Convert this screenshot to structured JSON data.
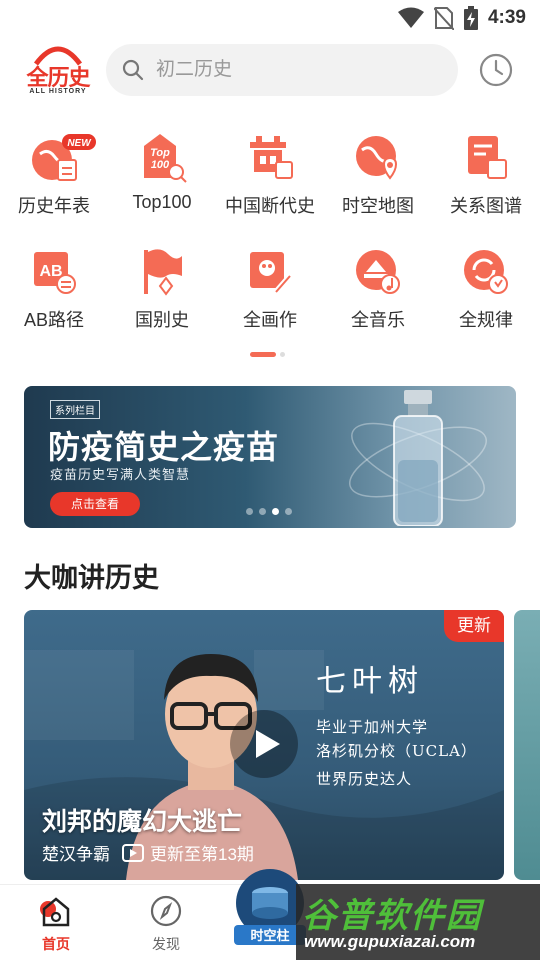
{
  "status_bar": {
    "time": "4:39"
  },
  "header": {
    "logo_text": "全历史",
    "logo_sub": "ALL HISTORY",
    "search_placeholder": "初二历史"
  },
  "grid": {
    "row1": [
      {
        "label": "历史年表",
        "icon": "calendar-globe-icon",
        "badge": "NEW"
      },
      {
        "label": "Top100",
        "icon": "top100-icon"
      },
      {
        "label": "中国断代史",
        "icon": "chinese-dynasty-icon"
      },
      {
        "label": "时空地图",
        "icon": "map-pin-globe-icon"
      },
      {
        "label": "关系图谱",
        "icon": "relation-graph-icon"
      }
    ],
    "row2": [
      {
        "label": "AB路径",
        "icon": "ab-path-icon"
      },
      {
        "label": "国别史",
        "icon": "flag-icon"
      },
      {
        "label": "全画作",
        "icon": "painting-icon"
      },
      {
        "label": "全音乐",
        "icon": "music-icon"
      },
      {
        "label": "全规律",
        "icon": "cycle-icon"
      }
    ]
  },
  "banner": {
    "tag": "系列栏目",
    "title": "防疫简史之疫苗",
    "subtitle": "疫苗历史写满人类智慧",
    "button": "点击查看"
  },
  "section": {
    "title": "大咖讲历史"
  },
  "card": {
    "badge": "更新",
    "speaker_name": "七叶树",
    "speaker_line1": "毕业于加州大学",
    "speaker_line2": "洛杉矶分校（UCLA）",
    "speaker_line3": "世界历史达人",
    "title": "刘邦的魔幻大逃亡",
    "category": "楚汉争霸",
    "episodes": "更新至第13期"
  },
  "nav": {
    "home": "首页",
    "discover": "发现",
    "center": "时空柱"
  },
  "watermark": {
    "title": "谷普软件园",
    "url": "www.gupuxiazai.com"
  },
  "colors": {
    "accent": "#e8372a",
    "icon_orange": "#f46b55"
  }
}
